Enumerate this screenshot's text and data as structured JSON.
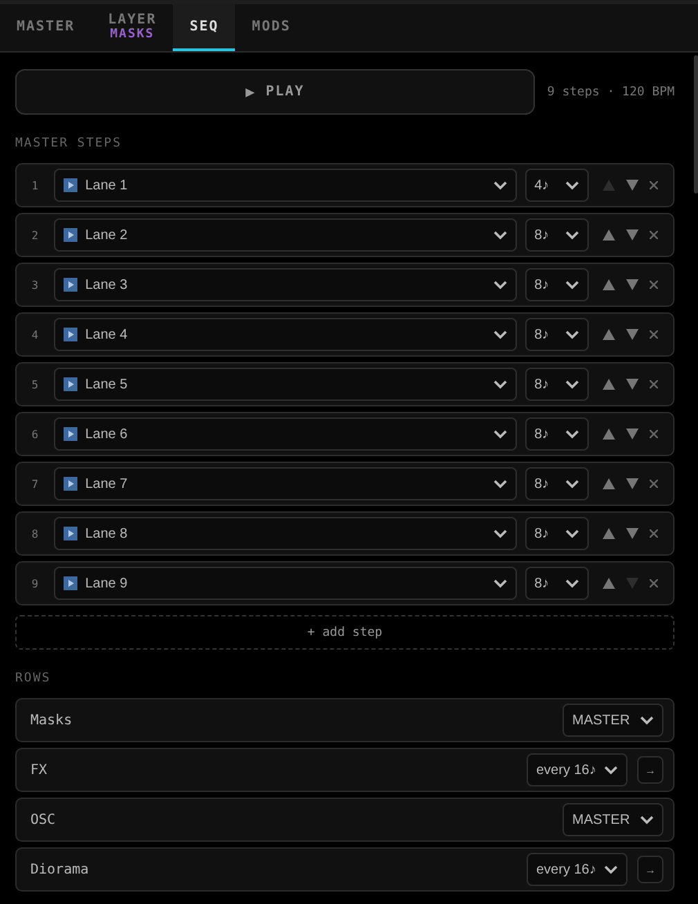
{
  "tabs": [
    {
      "label": "MASTER",
      "selected": false
    },
    {
      "label": "LAYER",
      "sublabel": "MASKS",
      "selected": false
    },
    {
      "label": "SEQ",
      "selected": true
    },
    {
      "label": "MODS",
      "selected": false
    }
  ],
  "play": {
    "icon": "▶",
    "label": "PLAY"
  },
  "summary": "9 steps · 120 BPM",
  "steps_heading": "MASTER STEPS",
  "steps": [
    {
      "index": "1",
      "lane": "Lane 1",
      "length": "4♪",
      "up_disabled": true,
      "down_disabled": false
    },
    {
      "index": "2",
      "lane": "Lane 2",
      "length": "8♪",
      "up_disabled": false,
      "down_disabled": false
    },
    {
      "index": "3",
      "lane": "Lane 3",
      "length": "8♪",
      "up_disabled": false,
      "down_disabled": false
    },
    {
      "index": "4",
      "lane": "Lane 4",
      "length": "8♪",
      "up_disabled": false,
      "down_disabled": false
    },
    {
      "index": "5",
      "lane": "Lane 5",
      "length": "8♪",
      "up_disabled": false,
      "down_disabled": false
    },
    {
      "index": "6",
      "lane": "Lane 6",
      "length": "8♪",
      "up_disabled": false,
      "down_disabled": false
    },
    {
      "index": "7",
      "lane": "Lane 7",
      "length": "8♪",
      "up_disabled": false,
      "down_disabled": false
    },
    {
      "index": "8",
      "lane": "Lane 8",
      "length": "8♪",
      "up_disabled": false,
      "down_disabled": false
    },
    {
      "index": "9",
      "lane": "Lane 9",
      "length": "8♪",
      "up_disabled": false,
      "down_disabled": true
    }
  ],
  "add_step": "+ add step",
  "rows_heading": "ROWS",
  "rows": [
    {
      "name": "Masks",
      "mode": "MASTER",
      "kind": "master"
    },
    {
      "name": "FX",
      "mode": "every 16♪",
      "kind": "interval",
      "action": "→"
    },
    {
      "name": "OSC",
      "mode": "MASTER",
      "kind": "master"
    },
    {
      "name": "Diorama",
      "mode": "every 16♪",
      "kind": "interval",
      "action": "→"
    }
  ]
}
